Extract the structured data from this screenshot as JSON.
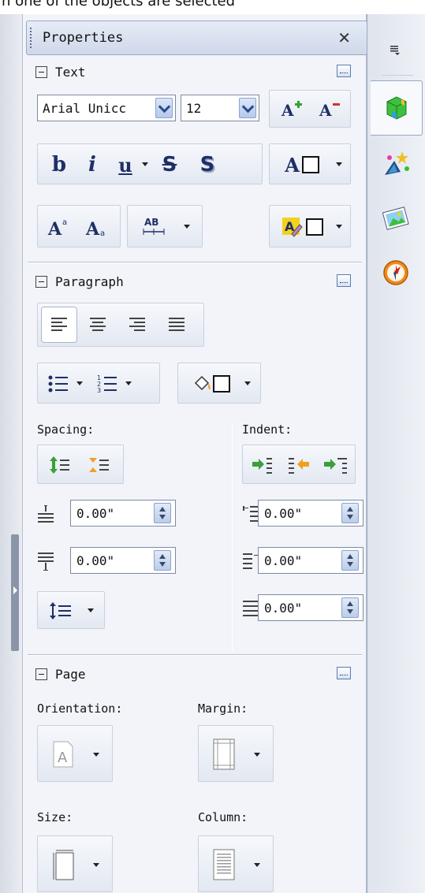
{
  "top_caption": "n one of the objects are selected",
  "panel": {
    "title": "Properties",
    "close_glyph": "✕",
    "text_section": {
      "title": "Text",
      "font_name": "Arial Unicc",
      "font_size": "12",
      "grow_font_glyph": "A⁺",
      "shrink_font_glyph": "A⁻",
      "bold_glyph": "b",
      "italic_glyph": "i",
      "underline_glyph": "u",
      "strike_glyph": "S",
      "shadow_glyph": "S",
      "font_color_glyph": "A",
      "superscript_glyph": "A",
      "subscript_glyph": "A",
      "char_spacing_glyph": "AB",
      "highlight_glyph": "A"
    },
    "paragraph_section": {
      "title": "Paragraph",
      "spacing_label": "Spacing:",
      "indent_label": "Indent:",
      "spacing_before": "0.00\"",
      "spacing_after": "0.00\"",
      "indent_left": "0.00\"",
      "indent_right": "0.00\"",
      "indent_first": "0.00\""
    },
    "page_section": {
      "title": "Page",
      "orientation_label": "Orientation:",
      "margin_label": "Margin:",
      "size_label": "Size:",
      "column_label": "Column:"
    }
  },
  "sidebar_tabs": [
    {
      "name": "options-menu",
      "icon": "list-menu-icon"
    },
    {
      "name": "objects",
      "icon": "cubes-icon",
      "active": true
    },
    {
      "name": "animation",
      "icon": "stars-icon"
    },
    {
      "name": "clip-art",
      "icon": "picture-icon"
    },
    {
      "name": "navigator",
      "icon": "compass-icon"
    }
  ],
  "colors": {
    "accent": "#1f2f66",
    "panel_bg": "#f2f4f9",
    "border": "#9aa8c2",
    "highlight_yellow": "#f2d21c",
    "compass_orange": "#f08a1c"
  }
}
